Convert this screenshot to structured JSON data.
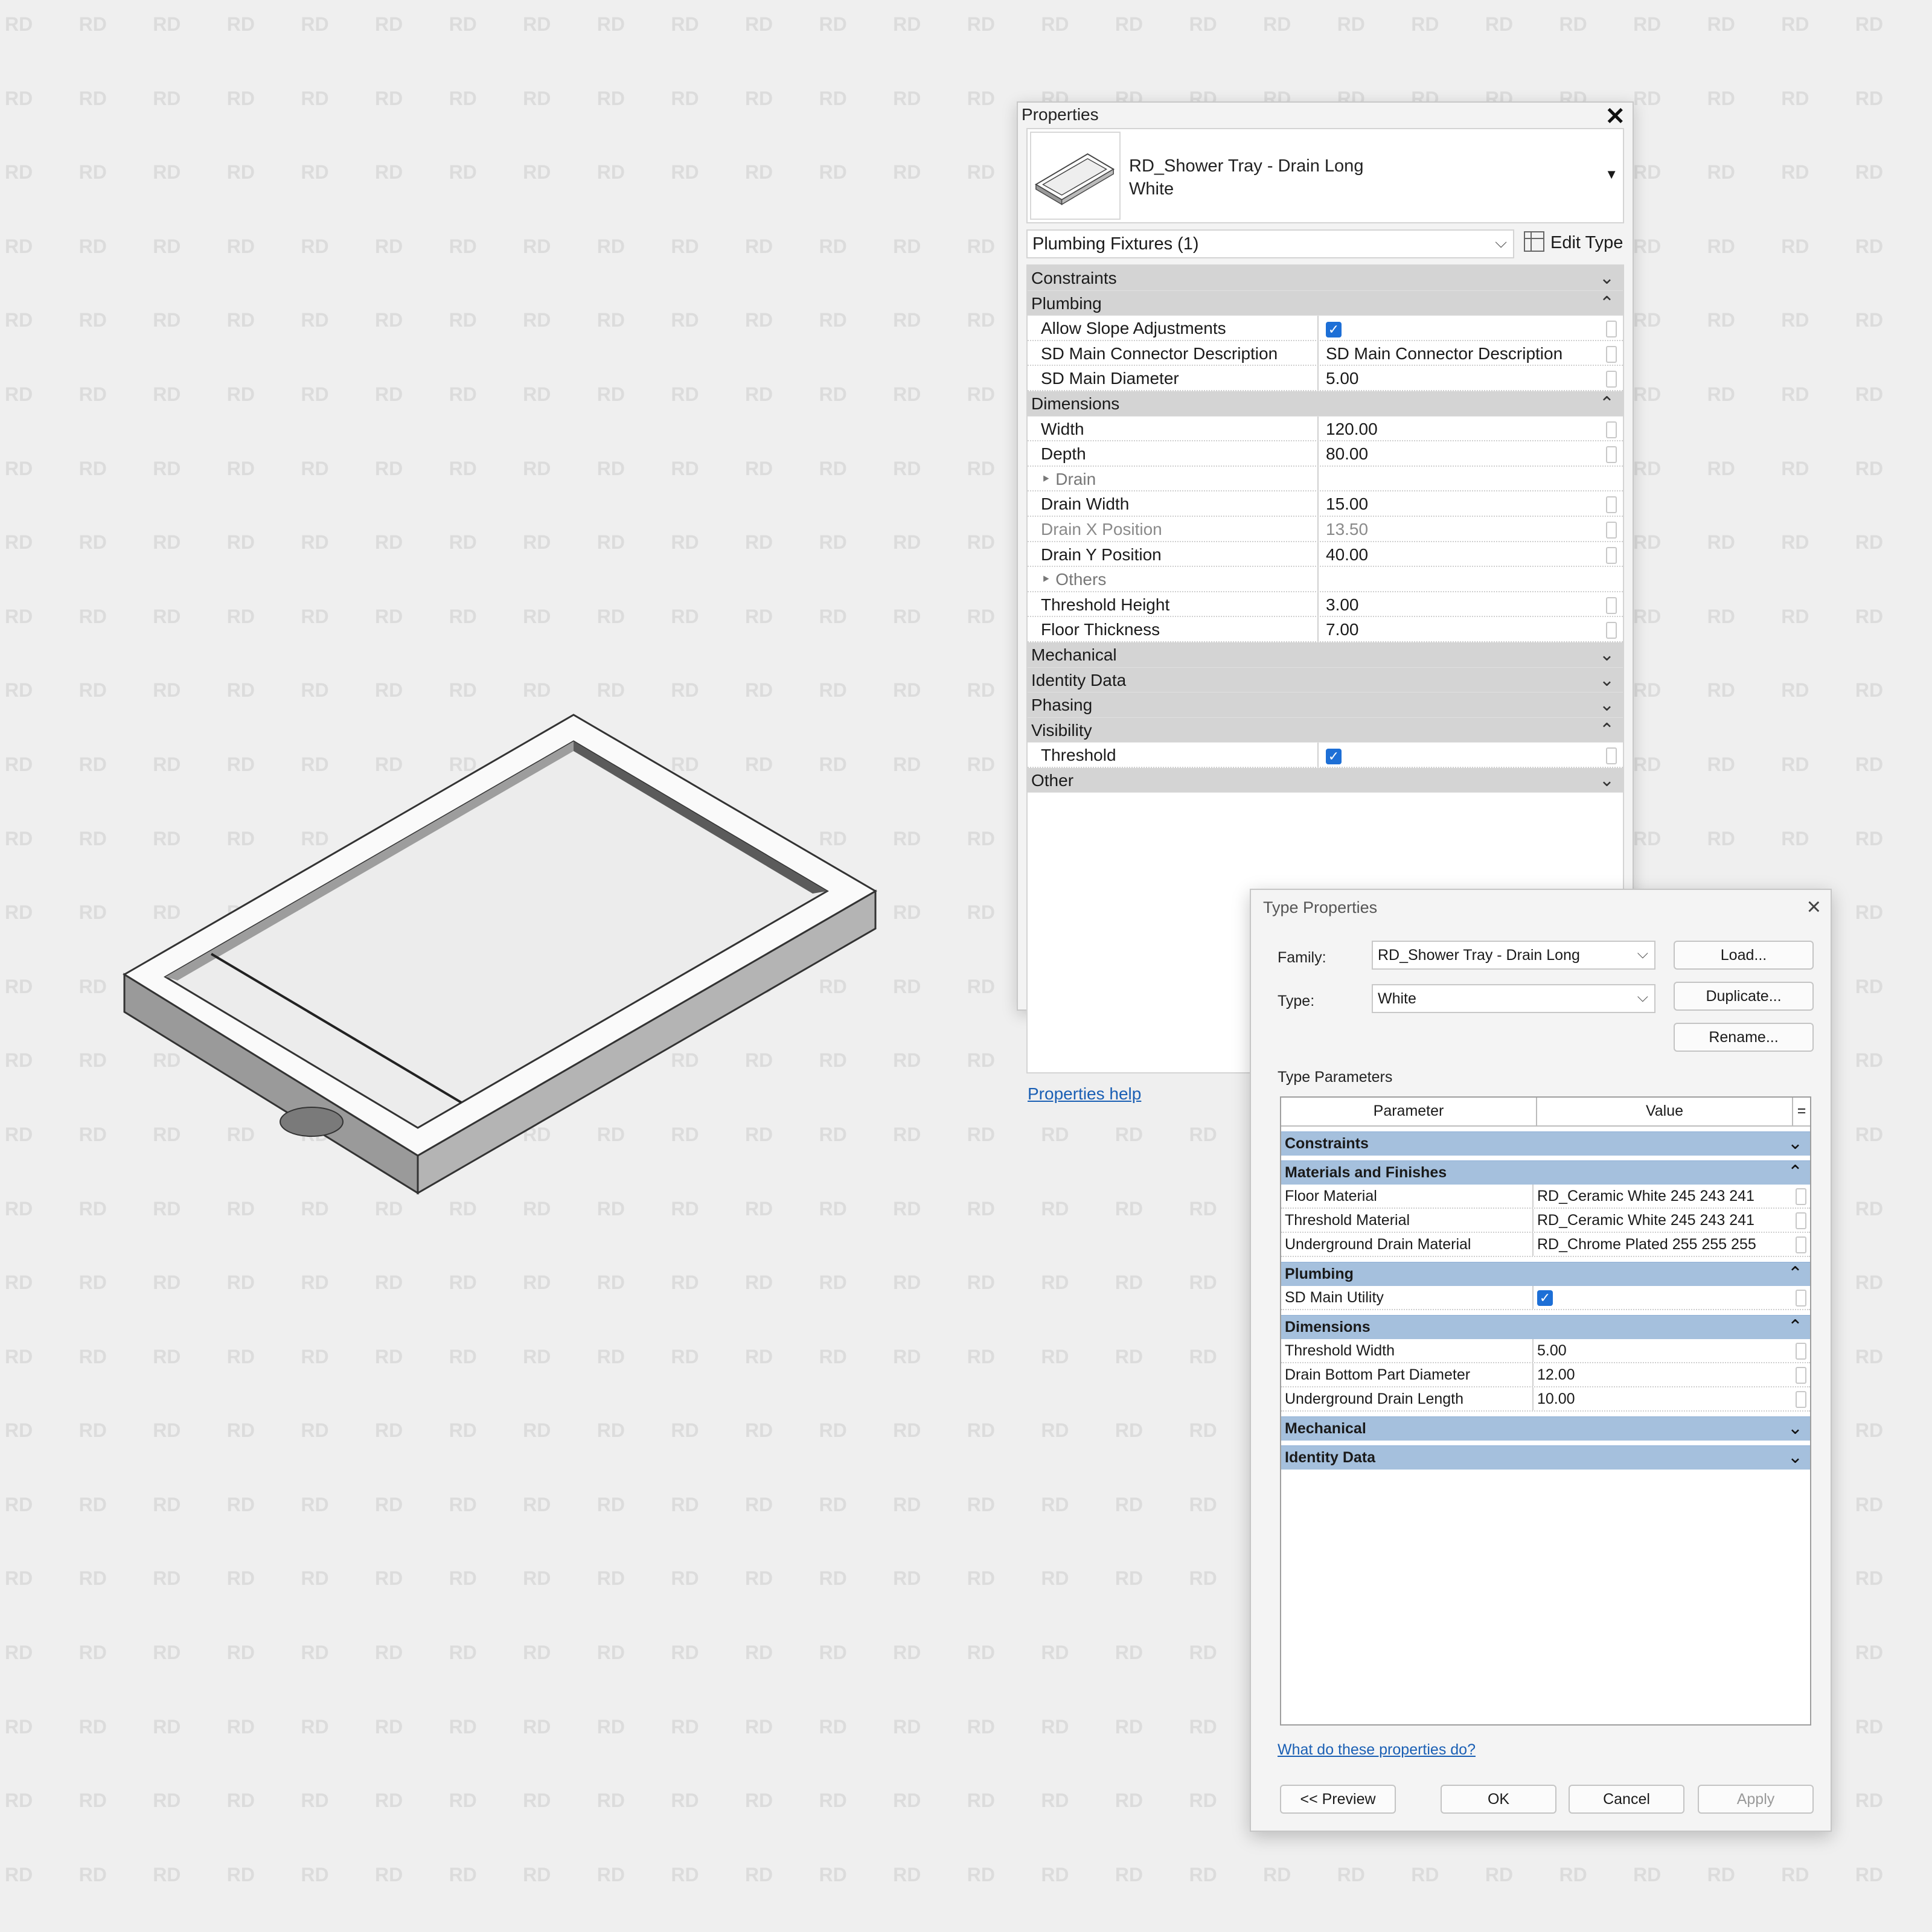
{
  "watermark": "RD",
  "properties": {
    "title": "Properties",
    "type_name_line1": "RD_Shower Tray - Drain Long",
    "type_name_line2": "White",
    "category": "Plumbing Fixtures (1)",
    "edit_type_label": "Edit Type",
    "help_link": "Properties help",
    "rows": [
      {
        "kind": "group",
        "label": "Constraints",
        "state": "collapsed"
      },
      {
        "kind": "group",
        "label": "Plumbing",
        "state": "expanded"
      },
      {
        "kind": "param",
        "name": "Allow Slope Adjustments",
        "value": "",
        "checkbox": true
      },
      {
        "kind": "param",
        "name": "SD Main Connector Description",
        "value": "SD Main Connector Description"
      },
      {
        "kind": "param",
        "name": "SD Main Diameter",
        "value": "5.00"
      },
      {
        "kind": "group",
        "label": "Dimensions",
        "state": "expanded"
      },
      {
        "kind": "param",
        "name": "Width",
        "value": "120.00"
      },
      {
        "kind": "param",
        "name": "Depth",
        "value": "80.00"
      },
      {
        "kind": "sub",
        "name": "‣ Drain",
        "value": ""
      },
      {
        "kind": "param",
        "name": "Drain Width",
        "value": "15.00"
      },
      {
        "kind": "grey",
        "name": "Drain X Position",
        "value": "13.50"
      },
      {
        "kind": "param",
        "name": "Drain Y Position",
        "value": "40.00"
      },
      {
        "kind": "sub",
        "name": "‣ Others",
        "value": ""
      },
      {
        "kind": "param",
        "name": "Threshold Height",
        "value": "3.00"
      },
      {
        "kind": "param",
        "name": "Floor Thickness",
        "value": "7.00"
      },
      {
        "kind": "group",
        "label": "Mechanical",
        "state": "collapsed"
      },
      {
        "kind": "group",
        "label": "Identity Data",
        "state": "collapsed"
      },
      {
        "kind": "group",
        "label": "Phasing",
        "state": "collapsed"
      },
      {
        "kind": "group",
        "label": "Visibility",
        "state": "expanded"
      },
      {
        "kind": "param",
        "name": "Threshold",
        "value": "",
        "checkbox": true
      },
      {
        "kind": "group",
        "label": "Other",
        "state": "collapsed"
      }
    ]
  },
  "type_properties": {
    "title": "Type Properties",
    "family_label": "Family:",
    "family_value": "RD_Shower Tray - Drain Long",
    "type_label": "Type:",
    "type_value": "White",
    "load_button": "Load...",
    "duplicate_button": "Duplicate...",
    "rename_button": "Rename...",
    "section_label": "Type Parameters",
    "col_parameter": "Parameter",
    "col_value": "Value",
    "col_eq": "=",
    "rows": [
      {
        "kind": "group",
        "label": "Constraints",
        "state": "collapsed"
      },
      {
        "kind": "group",
        "label": "Materials and Finishes",
        "state": "expanded"
      },
      {
        "kind": "param",
        "name": "Floor Material",
        "value": "RD_Ceramic White 245 243 241"
      },
      {
        "kind": "param",
        "name": "Threshold Material",
        "value": "RD_Ceramic White 245 243 241"
      },
      {
        "kind": "param",
        "name": "Underground Drain Material",
        "value": "RD_Chrome Plated 255 255 255"
      },
      {
        "kind": "group",
        "label": "Plumbing",
        "state": "expanded"
      },
      {
        "kind": "param",
        "name": "SD Main Utility",
        "value": "",
        "checkbox": true
      },
      {
        "kind": "group",
        "label": "Dimensions",
        "state": "expanded"
      },
      {
        "kind": "param",
        "name": "Threshold Width",
        "value": "5.00"
      },
      {
        "kind": "param",
        "name": "Drain Bottom Part Diameter",
        "value": "12.00"
      },
      {
        "kind": "param",
        "name": "Underground Drain Length",
        "value": "10.00"
      },
      {
        "kind": "group",
        "label": "Mechanical",
        "state": "collapsed"
      },
      {
        "kind": "group",
        "label": "Identity Data",
        "state": "collapsed"
      }
    ],
    "help_link": "What do these properties do?",
    "preview_button": "<< Preview",
    "ok_button": "OK",
    "cancel_button": "Cancel",
    "apply_button": "Apply"
  },
  "colors": {
    "accent_checkbox": "#1d6fd6",
    "group_header_properties": "#d4d4d4",
    "group_header_type": "#a5c0dd",
    "link": "#1a5fb4"
  }
}
